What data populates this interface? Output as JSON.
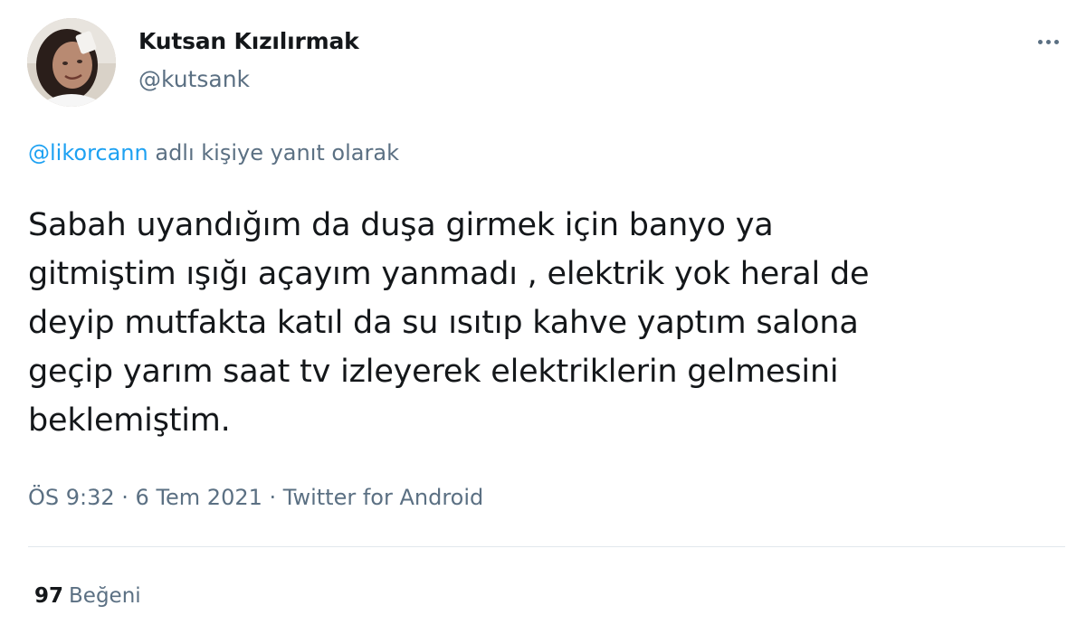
{
  "user": {
    "display_name": "Kutsan Kızılırmak",
    "handle": "@kutsank"
  },
  "reply": {
    "mention": "@likorcann",
    "suffix": " adlı kişiye yanıt olarak"
  },
  "tweet": {
    "text": "Sabah uyandığım da duşa girmek için banyo ya\ngitmiştim  ışığı açayım yanmadı ,  elektrik yok heral de\ndeyip mutfakta katıl da su ısıtıp kahve yaptım salona\ngeçip yarım saat  tv izleyerek elektriklerin gelmesini\nbeklemiştim."
  },
  "meta": {
    "time": "ÖS 9:32",
    "separator1": " · ",
    "date": "6 Tem 2021",
    "separator2": " · ",
    "source": "Twitter for Android"
  },
  "stats": {
    "likes_count": "97",
    "likes_label": "Beğeni"
  },
  "icons": {
    "more": "more-horizontal-icon"
  },
  "colors": {
    "text": "#14171a",
    "secondary": "#5b7083",
    "link": "#1da1f2",
    "divider": "#e1e8ed"
  }
}
